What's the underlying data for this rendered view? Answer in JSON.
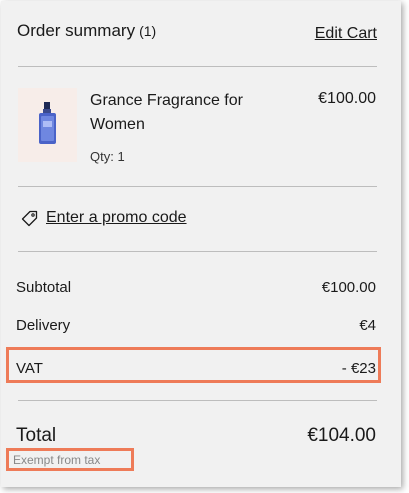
{
  "header": {
    "title": "Order summary",
    "count": "(1)",
    "edit_cart": "Edit Cart"
  },
  "item": {
    "name": "Grance Fragrance for Women",
    "price": "€100.00",
    "qty": "Qty: 1"
  },
  "promo": {
    "label": "Enter a promo code",
    "icon": "tag-icon"
  },
  "totals": {
    "subtotal_label": "Subtotal",
    "subtotal_value": "€100.00",
    "delivery_label": "Delivery",
    "delivery_value": "€4",
    "vat_label": "VAT",
    "vat_value": "- €23",
    "total_label": "Total",
    "total_value": "€104.00",
    "exempt_note": "Exempt from tax"
  },
  "colors": {
    "panel_bg": "#f1f1f1",
    "highlight": "#ee7b58"
  }
}
